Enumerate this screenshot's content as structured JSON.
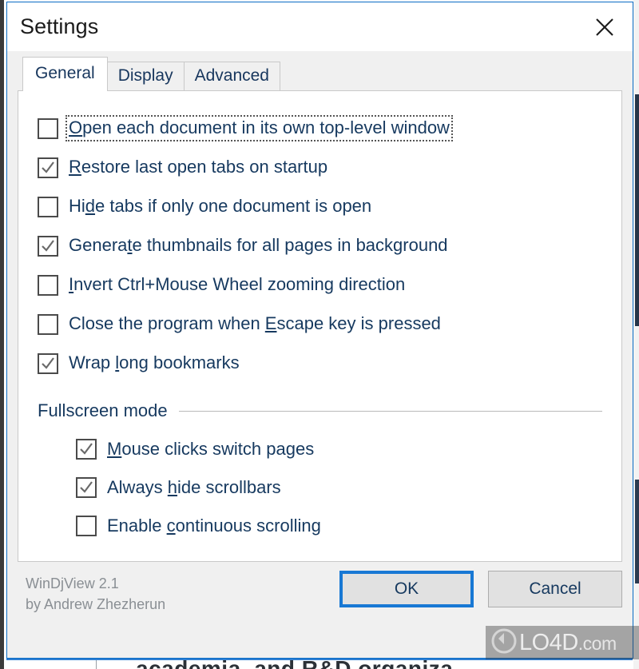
{
  "window": {
    "title": "Settings",
    "close_icon": "close-icon"
  },
  "tabs": [
    {
      "label": "General",
      "selected": true
    },
    {
      "label": "Display",
      "selected": false
    },
    {
      "label": "Advanced",
      "selected": false
    }
  ],
  "general": {
    "options": [
      {
        "label": "Open each document in its own top-level window",
        "accel": "O",
        "checked": false,
        "focused": true
      },
      {
        "label": "Restore last open tabs on startup",
        "accel": "R",
        "checked": true,
        "focused": false
      },
      {
        "label": "Hide tabs if only one document is open",
        "accel": "d",
        "checked": false,
        "focused": false
      },
      {
        "label": "Generate thumbnails for all pages in background",
        "accel": "t",
        "checked": true,
        "focused": false
      },
      {
        "label": "Invert Ctrl+Mouse Wheel zooming direction",
        "accel": "I",
        "checked": false,
        "focused": false
      },
      {
        "label": "Close the program when Escape key is pressed",
        "accel": "E",
        "checked": false,
        "focused": false
      },
      {
        "label": "Wrap long bookmarks",
        "accel": "l",
        "checked": true,
        "focused": false
      }
    ],
    "fullscreen_group": {
      "title": "Fullscreen mode",
      "options": [
        {
          "label": "Mouse clicks switch pages",
          "accel": "M",
          "checked": true,
          "focused": false
        },
        {
          "label": "Always hide scrollbars",
          "accel": "h",
          "checked": true,
          "focused": false
        },
        {
          "label": "Enable continuous scrolling",
          "accel": "c",
          "checked": false,
          "focused": false
        }
      ]
    }
  },
  "footer": {
    "version_line1": "WinDjView 2.1",
    "version_line2": "by Andrew Zhezherun",
    "buttons": [
      {
        "label": "OK",
        "default": true
      },
      {
        "label": "Cancel",
        "default": false
      }
    ]
  },
  "watermark": {
    "text": "LO4D",
    "suffix": ".com",
    "logo_icon": "lo4d-circle-logo-icon"
  },
  "background": {
    "bottom_text": "academia, and R&D organiza"
  },
  "colors": {
    "accent_blue": "#1878d4",
    "window_border": "#0a6cc4",
    "label_text": "#16395f",
    "dialog_face": "#f0f0f0",
    "panel_face": "#ffffff",
    "muted_text": "#8a8f94"
  }
}
